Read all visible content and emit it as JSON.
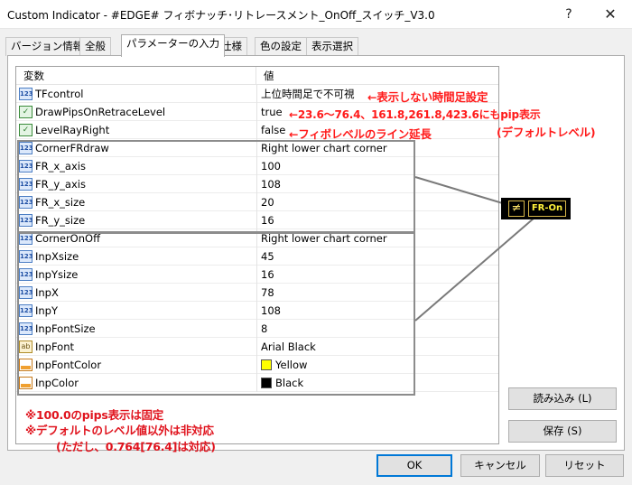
{
  "window": {
    "title": "Custom Indicator - #EDGE# フィボナッチ･リトレースメント_OnOff_スイッチ_V3.0",
    "help": "?",
    "close": "✕"
  },
  "tabs": [
    "バージョン情報",
    "全般",
    "パラメーターの入力",
    "仕様",
    "色の設定",
    "表示選択"
  ],
  "grid": {
    "col_variable": "変数",
    "col_value": "値",
    "rows": [
      {
        "type": "str",
        "name": "TFcontrol",
        "value": "上位時間足で不可視"
      },
      {
        "type": "bool",
        "name": "DrawPipsOnRetraceLevel",
        "value": "true"
      },
      {
        "type": "bool",
        "name": "LevelRayRight",
        "value": "false"
      },
      {
        "type": "num",
        "name": "CornerFRdraw",
        "value": "Right lower chart corner"
      },
      {
        "type": "num",
        "name": "FR_x_axis",
        "value": "100"
      },
      {
        "type": "num",
        "name": "FR_y_axis",
        "value": "108"
      },
      {
        "type": "num",
        "name": "FR_x_size",
        "value": "20"
      },
      {
        "type": "num",
        "name": "FR_y_size",
        "value": "16"
      },
      {
        "type": "num",
        "name": "CornerOnOff",
        "value": "Right lower chart corner"
      },
      {
        "type": "num",
        "name": "InpXsize",
        "value": "45"
      },
      {
        "type": "num",
        "name": "InpYsize",
        "value": "16"
      },
      {
        "type": "num",
        "name": "InpX",
        "value": "78"
      },
      {
        "type": "num",
        "name": "InpY",
        "value": "108"
      },
      {
        "type": "num",
        "name": "InpFontSize",
        "value": "8"
      },
      {
        "type": "ab",
        "name": "InpFont",
        "value": "Arial Black"
      },
      {
        "type": "col",
        "name": "InpFontColor",
        "value": "Yellow",
        "swatch": "#ffff00"
      },
      {
        "type": "col",
        "name": "InpColor",
        "value": "Black",
        "swatch": "#000000"
      }
    ]
  },
  "icons": {
    "num": "123",
    "bool": "✓",
    "ab": "ab"
  },
  "annotations": {
    "tf": "←表示しない時間足設定",
    "pips": "←23.6～76.4、161.8,261.8,423.6にもpip表示",
    "pips_sub": "(デフォルトレベル)",
    "ray": "←フィボレベルのライン延長",
    "note1": "※100.0のpips表示は固定",
    "note2": "※デフォルトのレベル値以外は非対応",
    "note3": "(ただし、0.764[76.4]は対応)"
  },
  "preview": {
    "neq": "≠",
    "label": "FR-On"
  },
  "buttons": {
    "load": "読み込み (L)",
    "save": "保存 (S)",
    "ok": "OK",
    "cancel": "キャンセル",
    "reset": "リセット"
  },
  "colors": {
    "annotation": "#ff1a1a",
    "accent": "#0078d7",
    "yellow": "#ffff00"
  }
}
